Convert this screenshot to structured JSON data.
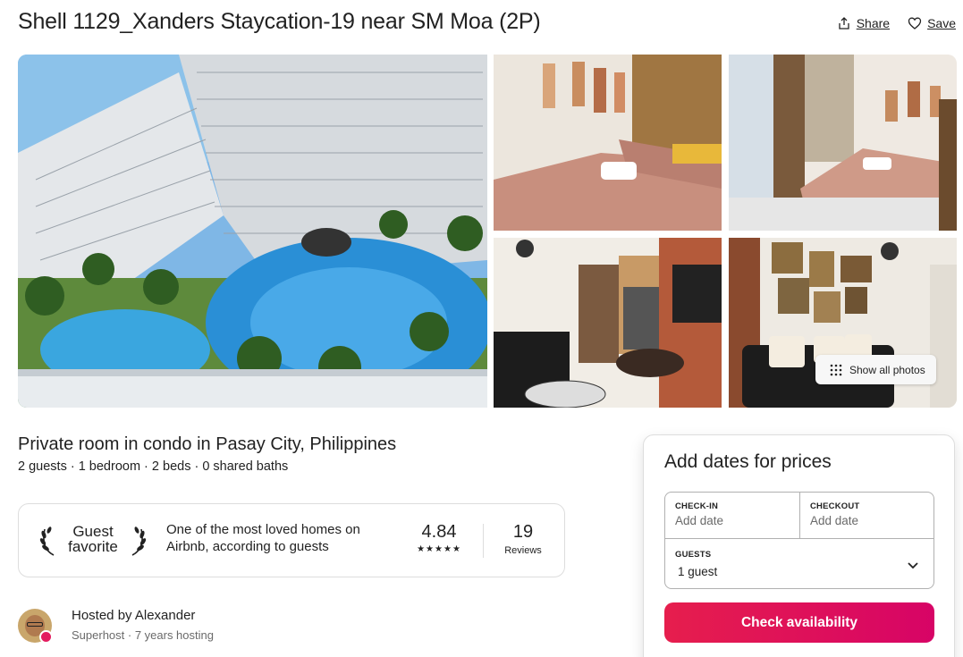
{
  "listing": {
    "title": "Shell 1129_Xanders Staycation-19 near SM Moa (2P)",
    "actions": {
      "share_label": "Share",
      "save_label": "Save",
      "share_icon": "share-icon",
      "save_icon": "heart-icon"
    },
    "gallery": {
      "show_all_label": "Show all photos"
    },
    "room_type": "Private room in condo in Pasay City, Philippines",
    "facts": "2 guests · 1 bedroom · 2 beds · 0 shared baths"
  },
  "guest_favorite": {
    "line1": "Guest",
    "line2": "favorite",
    "description": "One of the most loved homes on Airbnb, according to guests",
    "rating": "4.84",
    "stars": "★★★★★",
    "reviews_count": "19",
    "reviews_label": "Reviews"
  },
  "host": {
    "name": "Hosted by Alexander",
    "meta": "Superhost · 7 years hosting"
  },
  "booking": {
    "title": "Add dates for prices",
    "checkin_label": "CHECK-IN",
    "checkin_value": "Add date",
    "checkout_label": "CHECKOUT",
    "checkout_value": "Add date",
    "guests_label": "GUESTS",
    "guests_value": "1 guest",
    "cta": "Check availability"
  },
  "colors": {
    "brand": "#e61e4d",
    "brand_end": "#d70466",
    "text": "#222222",
    "muted": "#6a6a6a",
    "border": "#dddddd"
  }
}
